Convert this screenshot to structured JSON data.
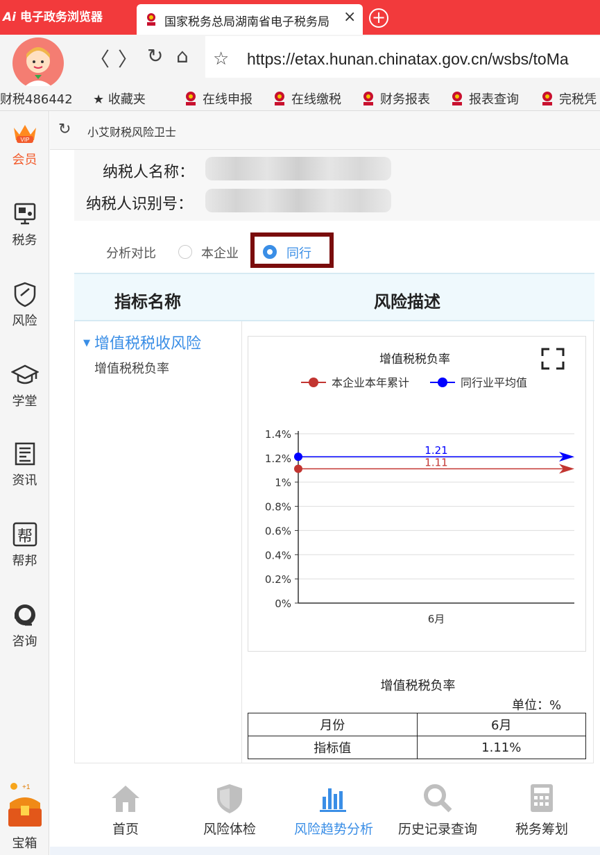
{
  "browser": {
    "app_title": "电子政务浏览器",
    "app_logo": "Ai",
    "tab_title": "国家税务总局湖南省电子税务局",
    "tab_close": "×",
    "new_tab": "+",
    "url": "https://etax.hunan.chinatax.gov.cn/wsbs/toMa",
    "account_id": "财税486442",
    "bookmarks": [
      "收藏夹",
      "在线申报",
      "在线缴税",
      "财务报表",
      "报表查询",
      "完税凭"
    ]
  },
  "sidebar": {
    "items": [
      {
        "label": "会员",
        "icon": "vip-crown-icon"
      },
      {
        "label": "税务",
        "icon": "tax-monitor-icon"
      },
      {
        "label": "风险",
        "icon": "shield-icon"
      },
      {
        "label": "学堂",
        "icon": "graduation-cap-icon"
      },
      {
        "label": "资讯",
        "icon": "news-icon"
      },
      {
        "label": "帮邦",
        "icon": "help-bang-icon"
      },
      {
        "label": "咨询",
        "icon": "headset-icon"
      }
    ],
    "treasure": {
      "label": "宝箱",
      "badge": "+1"
    }
  },
  "page": {
    "title": "小艾财税风险卫士",
    "taxpayer_name_label": "纳税人名称：",
    "taxpayer_id_label": "纳税人识别号：",
    "compare_label": "分析对比",
    "option_own": "本企业",
    "option_peer": "同行",
    "selected_option": "同行"
  },
  "table_header": {
    "name": "指标名称",
    "description": "风险描述"
  },
  "tree": {
    "group": "增值税税收风险",
    "item": "增值税税负率"
  },
  "chart_data": {
    "type": "line",
    "title": "增值税税负率",
    "categories": [
      "6月"
    ],
    "series": [
      {
        "name": "本企业本年累计",
        "values": [
          1.11
        ],
        "color": "#c23531"
      },
      {
        "name": "同行业平均值",
        "values": [
          1.21
        ],
        "color": "#0000ff"
      }
    ],
    "ylim": [
      0,
      1.4
    ],
    "yticks": [
      "0%",
      "0.2%",
      "0.4%",
      "0.6%",
      "0.8%",
      "1%",
      "1.2%",
      "1.4%"
    ],
    "ytick_values": [
      0,
      0.2,
      0.4,
      0.6,
      0.8,
      1.0,
      1.2,
      1.4
    ],
    "data_labels": [
      "1.11",
      "1.21"
    ],
    "grid": true,
    "legend_position": "top"
  },
  "data_table": {
    "title": "增值税税负率",
    "unit": "单位：%",
    "rows": [
      [
        "月份",
        "6月"
      ],
      [
        "指标值",
        "1.11%"
      ]
    ]
  },
  "bottom_nav": [
    {
      "label": "首页",
      "icon": "home-icon",
      "active": false
    },
    {
      "label": "风险体检",
      "icon": "shield-check-icon",
      "active": false
    },
    {
      "label": "风险趋势分析",
      "icon": "bar-chart-icon",
      "active": true
    },
    {
      "label": "历史记录查询",
      "icon": "search-icon",
      "active": false
    },
    {
      "label": "税务筹划",
      "icon": "calculator-icon",
      "active": false
    }
  ],
  "colors": {
    "brand_red": "#f23a3c",
    "accent_blue": "#3a8ee6",
    "highlight": "#7a0d0d"
  }
}
